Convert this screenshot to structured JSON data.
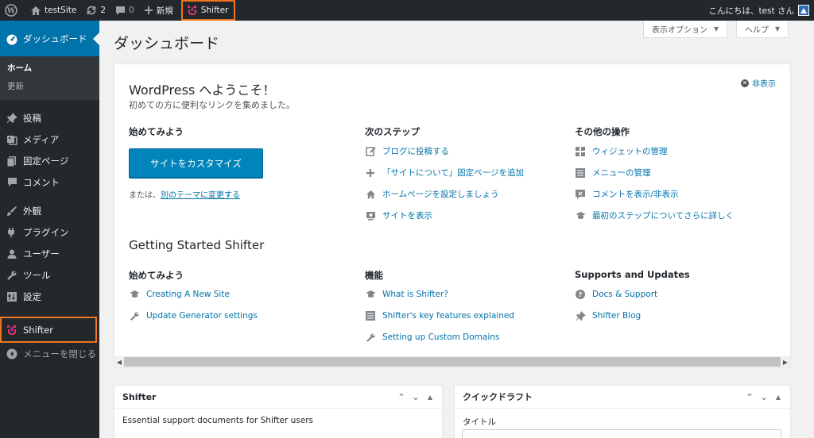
{
  "adminbar": {
    "site_name": "testSite",
    "updates_count": "2",
    "comments_count": "0",
    "new_label": "新規",
    "shifter_label": "Shifter",
    "greeting": "こんにちは、test さん"
  },
  "sidebar": {
    "dashboard_label": "ダッシュボード",
    "submenu": [
      "ホーム",
      "更新"
    ],
    "items": [
      {
        "label": "投稿",
        "icon": "pin-icon"
      },
      {
        "label": "メディア",
        "icon": "media-icon"
      },
      {
        "label": "固定ページ",
        "icon": "page-icon"
      },
      {
        "label": "コメント",
        "icon": "comment-icon"
      },
      {
        "label": "外観",
        "icon": "brush-icon"
      },
      {
        "label": "プラグイン",
        "icon": "plugin-icon"
      },
      {
        "label": "ユーザー",
        "icon": "user-icon"
      },
      {
        "label": "ツール",
        "icon": "wrench-icon"
      },
      {
        "label": "設定",
        "icon": "settings-icon"
      }
    ],
    "shifter_label": "Shifter",
    "collapse_label": "メニューを閉じる"
  },
  "main": {
    "page_title": "ダッシュボード",
    "screen_options": "表示オプション",
    "help": "ヘルプ"
  },
  "welcome": {
    "title": "WordPress へようこそ！",
    "subtitle": "初めての方に便利なリンクを集めました。",
    "dismiss": "非表示",
    "col1_head": "始めてみよう",
    "customize_button": "サイトをカスタマイズ",
    "alt_prefix": "または、",
    "alt_link": "別のテーマに変更する",
    "col2_head": "次のステップ",
    "next_steps": [
      "ブログに投稿する",
      "「サイトについて」固定ページを追加",
      "ホームページを設定しましょう",
      "サイトを表示"
    ],
    "col3_head": "その他の操作",
    "more_actions": [
      "ウィジェットの管理",
      "メニューの管理",
      "コメントを表示/非表示",
      "最初のステップについてさらに詳しく"
    ],
    "shifter_title": "Getting Started Shifter",
    "shifter_col1_head": "始めてみよう",
    "shifter_col1": [
      "Creating A New Site",
      "Update Generator settings"
    ],
    "shifter_col2_head": "機能",
    "shifter_col2": [
      "What is Shifter?",
      "Shifter's key features explained",
      "Setting up Custom Domains"
    ],
    "shifter_col3_head": "Supports and Updates",
    "shifter_col3": [
      "Docs & Support",
      "Shifter Blog"
    ]
  },
  "widgets": {
    "shifter_title": "Shifter",
    "shifter_body": "Essential support documents for Shifter users",
    "draft_title": "クイックドラフト",
    "draft_label": "タイトル"
  },
  "colors": {
    "accent": "#0073aa",
    "highlight": "#f0731f",
    "adminbar": "#23282d"
  }
}
